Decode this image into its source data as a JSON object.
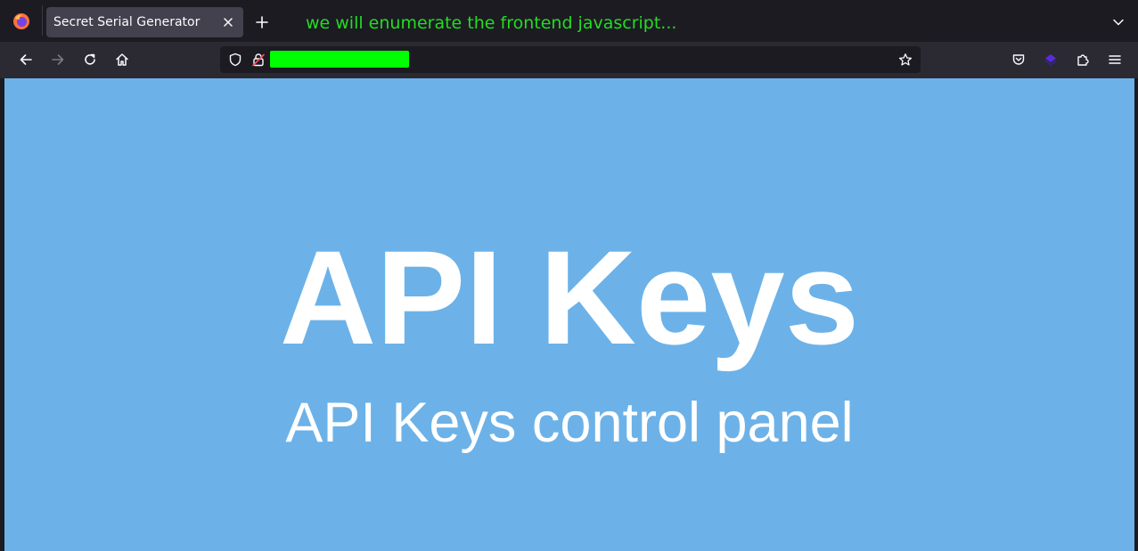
{
  "browser": {
    "tab": {
      "title": "Secret Serial Generator"
    },
    "annotation": "we will enumerate the frontend javascript...",
    "address_bar": {
      "url": ""
    },
    "icons": {
      "app": "firefox-icon",
      "tab_close": "close-icon",
      "new_tab": "plus-icon",
      "tab_list": "chevron-down-icon",
      "back": "back-arrow-icon",
      "forward": "forward-arrow-icon",
      "reload": "reload-icon",
      "home": "home-icon",
      "tracking": "shield-icon",
      "lock": "lock-icon",
      "bookmark": "star-icon",
      "pocket": "pocket-icon",
      "extension": "extension-icon",
      "extensions": "puzzle-icon",
      "menu": "hamburger-menu-icon"
    }
  },
  "colors": {
    "page_background": "#6cb2e8",
    "annotation": "#22dd22",
    "url_redaction": "#00ff00"
  },
  "page": {
    "heading": "API Keys",
    "subheading": "API Keys control panel"
  }
}
